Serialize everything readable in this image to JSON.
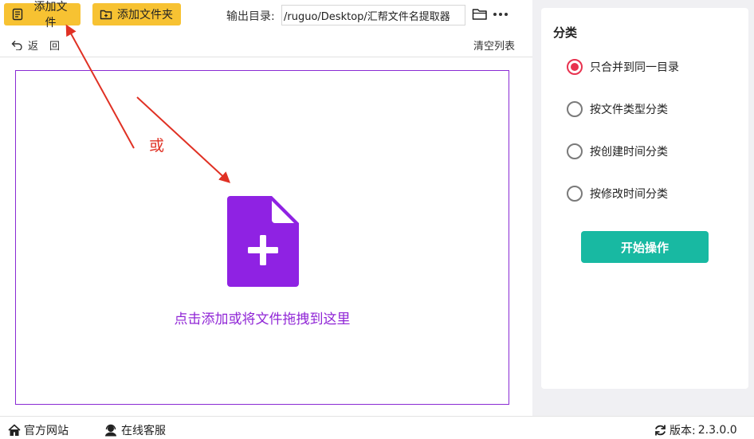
{
  "toolbar": {
    "add_file_label": "添加文件",
    "add_folder_label": "添加文件夹",
    "output_label": "输出目录:",
    "output_path": "/ruguo/Desktop/汇帮文件名提取器",
    "back_label": "返回",
    "clear_label": "清空列表"
  },
  "drop_zone": {
    "hint": "点击添加或将文件拖拽到这里",
    "icon": "file-add-icon",
    "icon_color": "#8f22e3"
  },
  "annotation": {
    "or_label": "或",
    "color": "#e03124"
  },
  "category": {
    "title": "分类",
    "options": [
      {
        "label": "只合并到同一目录",
        "selected": true
      },
      {
        "label": "按文件类型分类",
        "selected": false
      },
      {
        "label": "按创建时间分类",
        "selected": false
      },
      {
        "label": "按修改时间分类",
        "selected": false
      }
    ],
    "start_label": "开始操作"
  },
  "statusbar": {
    "website_label": "官方网站",
    "support_label": "在线客服",
    "version_label": "版本:",
    "version_value": "2.3.0.0"
  },
  "colors": {
    "accent_yellow": "#f7c232",
    "accent_purple": "#8f22e3",
    "accent_teal": "#18b9a2",
    "radio_selected": "#e8324f"
  }
}
